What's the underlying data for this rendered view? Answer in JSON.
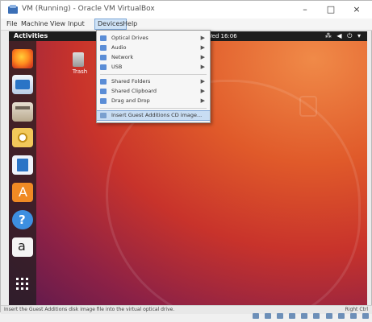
{
  "window": {
    "title": "VM (Running) - Oracle VM VirtualBox",
    "controls": {
      "minimize": "–",
      "maximize": "□",
      "close": "×"
    }
  },
  "menubar": {
    "items": [
      {
        "label": "File"
      },
      {
        "label": "Machine"
      },
      {
        "label": "View"
      },
      {
        "label": "Input"
      },
      {
        "label": "Devices",
        "active": true
      },
      {
        "label": "Help"
      }
    ]
  },
  "devices_menu": {
    "items": [
      {
        "label": "Optical Drives",
        "submenu": true
      },
      {
        "label": "Audio",
        "submenu": true
      },
      {
        "label": "Network",
        "submenu": true
      },
      {
        "label": "USB",
        "submenu": true
      },
      {
        "label": "Shared Folders",
        "submenu": true
      },
      {
        "label": "Shared Clipboard",
        "submenu": true
      },
      {
        "label": "Drag and Drop",
        "submenu": true
      },
      {
        "label": "Insert Guest Additions CD image...",
        "submenu": false,
        "highlighted": true
      }
    ],
    "submenu_arrow": "▶"
  },
  "guest": {
    "topbar": {
      "activities": "Activities",
      "clock": "Wed 16:06",
      "tray": "⁂ ◀ ⏻ ▾"
    },
    "desktop_icons": [
      {
        "label": "Trash"
      }
    ],
    "dock": [
      {
        "name": "firefox-icon"
      },
      {
        "name": "thunderbird-icon"
      },
      {
        "name": "files-icon"
      },
      {
        "name": "rhythmbox-icon"
      },
      {
        "name": "libreoffice-writer-icon"
      },
      {
        "name": "ubuntu-software-icon"
      },
      {
        "name": "help-icon"
      },
      {
        "name": "amazon-icon",
        "glyph": "a"
      },
      {
        "name": "show-applications-icon"
      }
    ]
  },
  "statusbar": {
    "message": "Insert the Guest Additions disk image file into the virtual optical drive.",
    "host_key": "Right Ctrl"
  },
  "colors": {
    "desktop_top": "#f08a48",
    "desktop_mid": "#c8332b",
    "desktop_bottom": "#5b1a4e",
    "menu_highlight": "#c8ddf3"
  }
}
